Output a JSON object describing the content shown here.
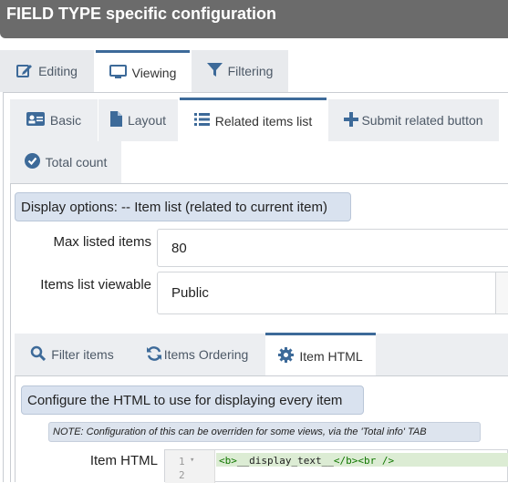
{
  "title": "FIELD TYPE specific configuration",
  "main_tabs": [
    {
      "label": "Editing",
      "icon": "edit-icon"
    },
    {
      "label": "Viewing",
      "icon": "monitor-icon",
      "active": true
    },
    {
      "label": "Filtering",
      "icon": "filter-icon"
    }
  ],
  "sub_tabs": [
    {
      "label": "Basic",
      "icon": "id-card-icon"
    },
    {
      "label": "Layout",
      "icon": "file-icon"
    },
    {
      "label": "Related items list",
      "icon": "list-icon",
      "active": true
    },
    {
      "label": "Submit related button",
      "icon": "plus-icon"
    },
    {
      "label": "Total count",
      "icon": "check-circle-icon"
    }
  ],
  "display_options_label": "Display options: -- Item list (related to current item)",
  "max_listed_items": {
    "label": "Max listed items",
    "value": "80"
  },
  "items_list_viewable": {
    "label": "Items list viewable",
    "value": "Public"
  },
  "inner_tabs": [
    {
      "label": "Filter items",
      "icon": "search-icon"
    },
    {
      "label": "Items Ordering",
      "icon": "sync-icon"
    },
    {
      "label": "Item HTML",
      "icon": "gear-icon",
      "active": true
    }
  ],
  "configure_label": "Configure the HTML to use for displaying every item",
  "note": "NOTE: Configuration of this can be overriden for some views, via the 'Total info' TAB",
  "item_html": {
    "label": "Item HTML",
    "lines": [
      {
        "number": "1",
        "fold": "▾",
        "tag_open": "<b>",
        "text": "__display_text__",
        "tag_close": "</b><br />"
      },
      {
        "number": "2"
      }
    ]
  },
  "colors": {
    "title_bg": "#6b6b6b",
    "active_border": "#3d6a99",
    "label_bg": "#d9e2ef",
    "code_tag": "#117700"
  }
}
